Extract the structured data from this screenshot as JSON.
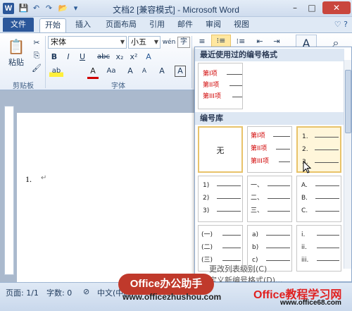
{
  "window": {
    "title": "文档2 [兼容模式] - Microsoft Word",
    "app_icon_letter": "W",
    "controls": [
      "–",
      "□",
      "✕"
    ]
  },
  "quick_access": {
    "save": "💾",
    "undo": "↶",
    "redo": "↷",
    "open": "📂",
    "more": "▾"
  },
  "tabs": [
    {
      "label": "文件"
    },
    {
      "label": "开始"
    },
    {
      "label": "插入"
    },
    {
      "label": "页面布局"
    },
    {
      "label": "引用"
    },
    {
      "label": "邮件"
    },
    {
      "label": "审阅"
    },
    {
      "label": "视图"
    }
  ],
  "help_icons": "♡ ?",
  "ribbon": {
    "clipboard": {
      "paste_label": "粘贴",
      "group_label": "剪贴板",
      "cut": "✂",
      "copy": "⎘",
      "format_painter": "🖌"
    },
    "font": {
      "group_label": "字体",
      "font_name": "宋体",
      "font_size": "小五",
      "bold": "B",
      "italic": "I",
      "underline": "U",
      "strike": "abc",
      "subscript": "x₂",
      "superscript": "x²",
      "grow": "A",
      "shrink": "A",
      "change_case": "Aa",
      "clear": "A",
      "highlight": "ab",
      "font_color": "A",
      "char_border": "A",
      "wen": "wén",
      "enclose": "字"
    },
    "paragraph": {
      "bullets": "≡",
      "numbering": "⁝≡",
      "multilevel": "⁝≡"
    },
    "styles": {
      "label": "A"
    }
  },
  "gallery": {
    "recent_header": "最近使用过的编号格式",
    "library_header": "编号库",
    "recent_items": [
      "第I项",
      "第II项",
      "第III项"
    ],
    "library": [
      {
        "kind": "none",
        "text": "无"
      },
      {
        "kind": "lines",
        "color": "red",
        "items": [
          "第I项",
          "第II项",
          "第III项"
        ]
      },
      {
        "kind": "lines",
        "color": "dark",
        "items": [
          "1.",
          "2.",
          "3."
        ]
      },
      {
        "kind": "lines",
        "color": "dark",
        "items": [
          "1)",
          "2)",
          "3)"
        ]
      },
      {
        "kind": "lines",
        "color": "dark",
        "items": [
          "一、",
          "二、",
          "三、"
        ]
      },
      {
        "kind": "lines",
        "color": "dark",
        "items": [
          "A.",
          "B.",
          "C."
        ]
      },
      {
        "kind": "lines",
        "color": "dark",
        "items": [
          "(一)",
          "(二)",
          "(三)"
        ]
      },
      {
        "kind": "lines",
        "color": "dark",
        "items": [
          "a)",
          "b)",
          "c)"
        ]
      },
      {
        "kind": "lines",
        "color": "dark",
        "items": [
          "i.",
          "ii.",
          "iii."
        ]
      }
    ],
    "menu": [
      "更改列表级别(C)",
      "定义新编号格式(D)..."
    ]
  },
  "document": {
    "list_number": "1.",
    "para_mark": "↵"
  },
  "status": {
    "page": "页面: 1/1",
    "words": "字数: 0",
    "lang": "中文(中国)"
  },
  "watermarks": {
    "left_badge": "Office办公助手",
    "left_url": "www.officezhushou.com",
    "right_title": "Office教程学习网",
    "right_url": "www.office68.com"
  }
}
